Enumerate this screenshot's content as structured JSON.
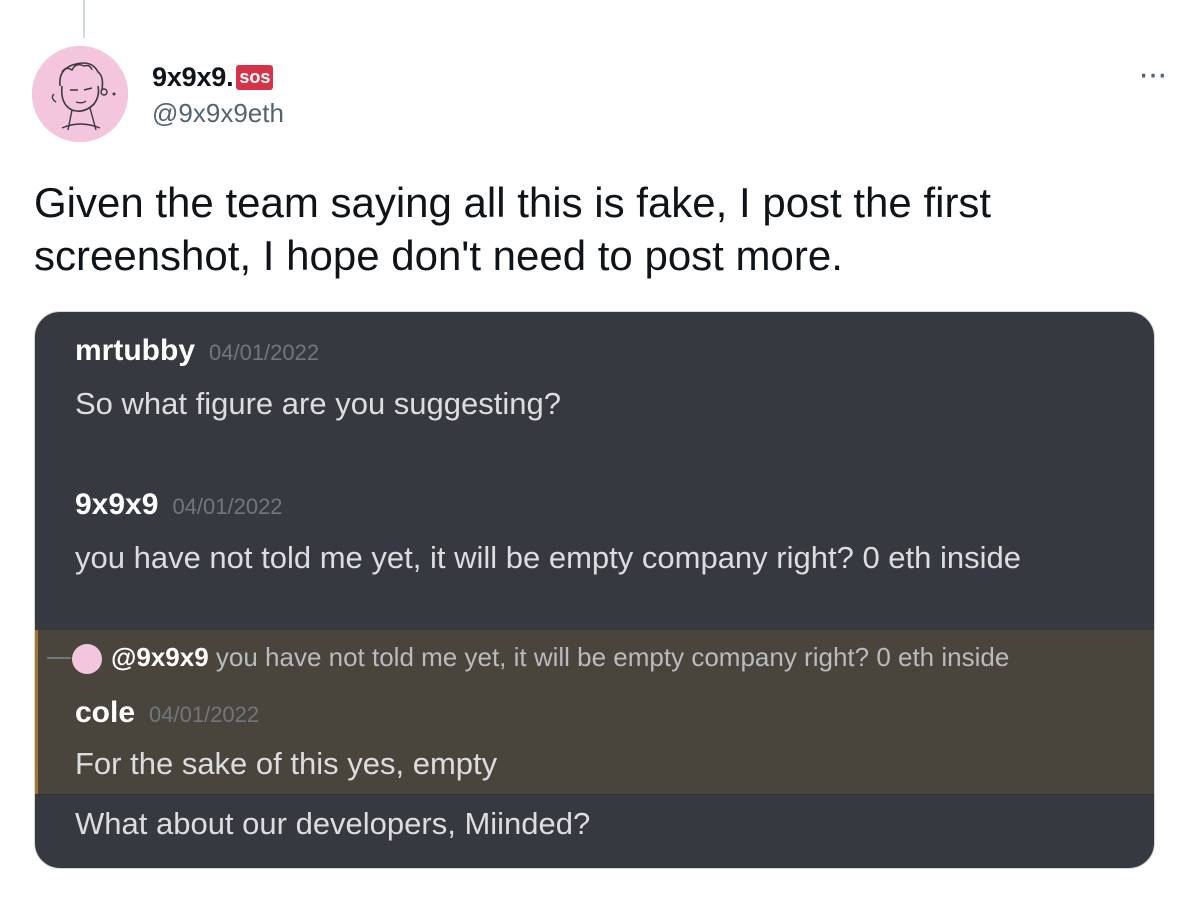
{
  "tweet": {
    "author": {
      "display_name": "9x9x9.",
      "badge": "sos",
      "handle": "@9x9x9eth"
    },
    "more_label": "···",
    "text_line1": "Given the team saying all this is fake, I post the first",
    "text_line2": "screenshot, I hope don't need to post more."
  },
  "discord": {
    "messages": [
      {
        "author": "mrtubby",
        "time": "04/01/2022",
        "body": "So what figure are you suggesting?"
      },
      {
        "author": "9x9x9",
        "time": "04/01/2022",
        "body": "you have not told me yet, it will be empty company right? 0 eth inside"
      },
      {
        "author": "cole",
        "time": "04/01/2022",
        "body": "For the sake of this yes, empty"
      }
    ],
    "reply": {
      "mention": "@9x9x9",
      "text": " you have not told me yet, it will be empty company right? 0 eth inside"
    },
    "last_line": "What about our developers, Miinded?"
  },
  "colors": {
    "discord_bg": "#36393f",
    "highlight_bg": "#49443c",
    "badge_red": "#d6334a",
    "avatar_pink": "#f3c6dd"
  },
  "icons": {
    "more": "more-horizontal-icon",
    "avatar": "cartoon-avatar"
  }
}
